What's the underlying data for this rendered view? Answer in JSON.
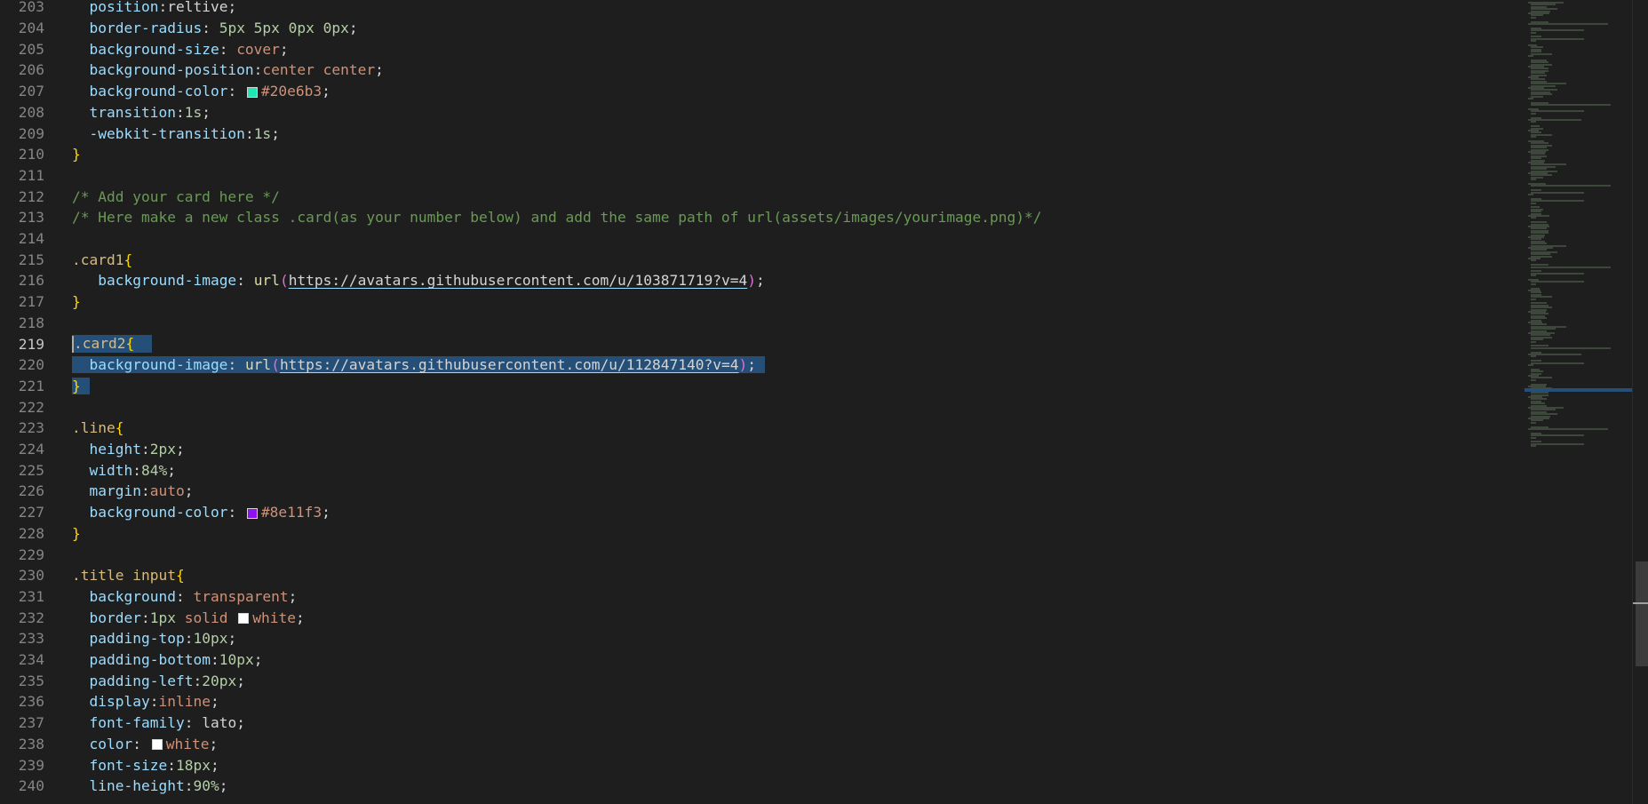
{
  "editor": {
    "active_line": "219",
    "lines": [
      {
        "n": "203",
        "tokens": [
          {
            "t": "  ",
            "c": ""
          },
          {
            "t": "position",
            "c": "t-prop"
          },
          {
            "t": ":",
            "c": "t-punc"
          },
          {
            "t": "reltive",
            "c": "t-punc"
          },
          {
            "t": ";",
            "c": "t-punc"
          }
        ]
      },
      {
        "n": "204",
        "tokens": [
          {
            "t": "  ",
            "c": ""
          },
          {
            "t": "border-radius",
            "c": "t-prop"
          },
          {
            "t": ": ",
            "c": "t-punc"
          },
          {
            "t": "5px 5px 0px 0px",
            "c": "t-num"
          },
          {
            "t": ";",
            "c": "t-punc"
          }
        ]
      },
      {
        "n": "205",
        "tokens": [
          {
            "t": "  ",
            "c": ""
          },
          {
            "t": "background-size",
            "c": "t-prop"
          },
          {
            "t": ": ",
            "c": "t-punc"
          },
          {
            "t": "cover",
            "c": "t-val"
          },
          {
            "t": ";",
            "c": "t-punc"
          }
        ]
      },
      {
        "n": "206",
        "tokens": [
          {
            "t": "  ",
            "c": ""
          },
          {
            "t": "background-position",
            "c": "t-prop"
          },
          {
            "t": ":",
            "c": "t-punc"
          },
          {
            "t": "center center",
            "c": "t-val"
          },
          {
            "t": ";",
            "c": "t-punc"
          }
        ]
      },
      {
        "n": "207",
        "tokens": [
          {
            "t": "  ",
            "c": ""
          },
          {
            "t": "background-color",
            "c": "t-prop"
          },
          {
            "t": ": ",
            "c": "t-punc"
          },
          {
            "swatch": "#20e6b3"
          },
          {
            "t": "#20e6b3",
            "c": "t-val"
          },
          {
            "t": ";",
            "c": "t-punc"
          }
        ]
      },
      {
        "n": "208",
        "tokens": [
          {
            "t": "  ",
            "c": ""
          },
          {
            "t": "transition",
            "c": "t-prop"
          },
          {
            "t": ":",
            "c": "t-punc"
          },
          {
            "t": "1s",
            "c": "t-num"
          },
          {
            "t": ";",
            "c": "t-punc"
          }
        ]
      },
      {
        "n": "209",
        "tokens": [
          {
            "t": "  ",
            "c": ""
          },
          {
            "t": "-webkit-transition",
            "c": "t-prop"
          },
          {
            "t": ":",
            "c": "t-punc"
          },
          {
            "t": "1s",
            "c": "t-num"
          },
          {
            "t": ";",
            "c": "t-punc"
          }
        ]
      },
      {
        "n": "210",
        "tokens": [
          {
            "t": "}",
            "c": "t-brace"
          }
        ]
      },
      {
        "n": "211",
        "tokens": []
      },
      {
        "n": "212",
        "tokens": [
          {
            "t": "/* Add your card here */",
            "c": "t-com"
          }
        ]
      },
      {
        "n": "213",
        "tokens": [
          {
            "t": "/* Here make a new class .card(as your number below) and add the same path of url(assets/images/yourimage.png)*/",
            "c": "t-com"
          }
        ]
      },
      {
        "n": "214",
        "tokens": []
      },
      {
        "n": "215",
        "tokens": [
          {
            "t": ".card1",
            "c": "t-sel"
          },
          {
            "t": "{",
            "c": "t-brace"
          }
        ]
      },
      {
        "n": "216",
        "tokens": [
          {
            "t": "   ",
            "c": ""
          },
          {
            "t": "background-image",
            "c": "t-prop"
          },
          {
            "t": ": ",
            "c": "t-punc"
          },
          {
            "t": "url",
            "c": "t-fn"
          },
          {
            "t": "(",
            "c": "t-paren"
          },
          {
            "t": "https://avatars.githubusercontent.com/u/103871719?v=4",
            "c": "t-url"
          },
          {
            "t": ")",
            "c": "t-paren"
          },
          {
            "t": ";",
            "c": "t-punc"
          }
        ]
      },
      {
        "n": "217",
        "tokens": [
          {
            "t": "}",
            "c": "t-brace"
          }
        ]
      },
      {
        "n": "218",
        "tokens": []
      },
      {
        "n": "219",
        "sel": true,
        "tokens": [
          {
            "cursor": true
          },
          {
            "t": ".card2",
            "c": "t-sel"
          },
          {
            "t": "{",
            "c": "t-brace"
          },
          {
            "t": "  ",
            "c": ""
          }
        ]
      },
      {
        "n": "220",
        "sel": true,
        "tokens": [
          {
            "t": "  ",
            "c": ""
          },
          {
            "t": "background-image",
            "c": "t-prop"
          },
          {
            "t": ": ",
            "c": "t-punc"
          },
          {
            "t": "url",
            "c": "t-fn"
          },
          {
            "t": "(",
            "c": "t-paren"
          },
          {
            "t": "https://avatars.githubusercontent.com/u/112847140?v=4",
            "c": "t-url"
          },
          {
            "t": ")",
            "c": "t-paren"
          },
          {
            "t": "; ",
            "c": "t-punc"
          }
        ]
      },
      {
        "n": "221",
        "sel": true,
        "tokens": [
          {
            "t": "}",
            "c": "t-brace"
          },
          {
            "t": " ",
            "c": ""
          }
        ]
      },
      {
        "n": "222",
        "tokens": []
      },
      {
        "n": "223",
        "tokens": [
          {
            "t": ".line",
            "c": "t-sel"
          },
          {
            "t": "{",
            "c": "t-brace"
          }
        ]
      },
      {
        "n": "224",
        "tokens": [
          {
            "t": "  ",
            "c": ""
          },
          {
            "t": "height",
            "c": "t-prop"
          },
          {
            "t": ":",
            "c": "t-punc"
          },
          {
            "t": "2px",
            "c": "t-num"
          },
          {
            "t": ";",
            "c": "t-punc"
          }
        ]
      },
      {
        "n": "225",
        "tokens": [
          {
            "t": "  ",
            "c": ""
          },
          {
            "t": "width",
            "c": "t-prop"
          },
          {
            "t": ":",
            "c": "t-punc"
          },
          {
            "t": "84%",
            "c": "t-num"
          },
          {
            "t": ";",
            "c": "t-punc"
          }
        ]
      },
      {
        "n": "226",
        "tokens": [
          {
            "t": "  ",
            "c": ""
          },
          {
            "t": "margin",
            "c": "t-prop"
          },
          {
            "t": ":",
            "c": "t-punc"
          },
          {
            "t": "auto",
            "c": "t-val"
          },
          {
            "t": ";",
            "c": "t-punc"
          }
        ]
      },
      {
        "n": "227",
        "tokens": [
          {
            "t": "  ",
            "c": ""
          },
          {
            "t": "background-color",
            "c": "t-prop"
          },
          {
            "t": ": ",
            "c": "t-punc"
          },
          {
            "swatch": "#8e11f3"
          },
          {
            "t": "#8e11f3",
            "c": "t-val"
          },
          {
            "t": ";",
            "c": "t-punc"
          }
        ]
      },
      {
        "n": "228",
        "tokens": [
          {
            "t": "}",
            "c": "t-brace"
          }
        ]
      },
      {
        "n": "229",
        "tokens": []
      },
      {
        "n": "230",
        "tokens": [
          {
            "t": ".title input",
            "c": "t-sel"
          },
          {
            "t": "{",
            "c": "t-brace"
          }
        ]
      },
      {
        "n": "231",
        "tokens": [
          {
            "t": "  ",
            "c": ""
          },
          {
            "t": "background",
            "c": "t-prop"
          },
          {
            "t": ": ",
            "c": "t-punc"
          },
          {
            "t": "transparent",
            "c": "t-val"
          },
          {
            "t": ";",
            "c": "t-punc"
          }
        ]
      },
      {
        "n": "232",
        "tokens": [
          {
            "t": "  ",
            "c": ""
          },
          {
            "t": "border",
            "c": "t-prop"
          },
          {
            "t": ":",
            "c": "t-punc"
          },
          {
            "t": "1px",
            "c": "t-num"
          },
          {
            "t": " solid ",
            "c": "t-val"
          },
          {
            "swatch": "#ffffff"
          },
          {
            "t": "white",
            "c": "t-val"
          },
          {
            "t": ";",
            "c": "t-punc"
          }
        ]
      },
      {
        "n": "233",
        "tokens": [
          {
            "t": "  ",
            "c": ""
          },
          {
            "t": "padding-top",
            "c": "t-prop"
          },
          {
            "t": ":",
            "c": "t-punc"
          },
          {
            "t": "10px",
            "c": "t-num"
          },
          {
            "t": ";",
            "c": "t-punc"
          }
        ]
      },
      {
        "n": "234",
        "tokens": [
          {
            "t": "  ",
            "c": ""
          },
          {
            "t": "padding-bottom",
            "c": "t-prop"
          },
          {
            "t": ":",
            "c": "t-punc"
          },
          {
            "t": "10px",
            "c": "t-num"
          },
          {
            "t": ";",
            "c": "t-punc"
          }
        ]
      },
      {
        "n": "235",
        "tokens": [
          {
            "t": "  ",
            "c": ""
          },
          {
            "t": "padding-left",
            "c": "t-prop"
          },
          {
            "t": ":",
            "c": "t-punc"
          },
          {
            "t": "20px",
            "c": "t-num"
          },
          {
            "t": ";",
            "c": "t-punc"
          }
        ]
      },
      {
        "n": "236",
        "tokens": [
          {
            "t": "  ",
            "c": ""
          },
          {
            "t": "display",
            "c": "t-prop"
          },
          {
            "t": ":",
            "c": "t-punc"
          },
          {
            "t": "inline",
            "c": "t-val"
          },
          {
            "t": ";",
            "c": "t-punc"
          }
        ]
      },
      {
        "n": "237",
        "tokens": [
          {
            "t": "  ",
            "c": ""
          },
          {
            "t": "font-family",
            "c": "t-prop"
          },
          {
            "t": ": ",
            "c": "t-punc"
          },
          {
            "t": "lato",
            "c": "t-punc"
          },
          {
            "t": ";",
            "c": "t-punc"
          }
        ]
      },
      {
        "n": "238",
        "tokens": [
          {
            "t": "  ",
            "c": ""
          },
          {
            "t": "color",
            "c": "t-prop"
          },
          {
            "t": ": ",
            "c": "t-punc"
          },
          {
            "swatch": "#ffffff"
          },
          {
            "t": "white",
            "c": "t-val"
          },
          {
            "t": ";",
            "c": "t-punc"
          }
        ]
      },
      {
        "n": "239",
        "tokens": [
          {
            "t": "  ",
            "c": ""
          },
          {
            "t": "font-size",
            "c": "t-prop"
          },
          {
            "t": ":",
            "c": "t-punc"
          },
          {
            "t": "18px",
            "c": "t-num"
          },
          {
            "t": ";",
            "c": "t-punc"
          }
        ]
      },
      {
        "n": "240",
        "tokens": [
          {
            "t": "  ",
            "c": ""
          },
          {
            "t": "line-height",
            "c": "t-prop"
          },
          {
            "t": ":",
            "c": "t-punc"
          },
          {
            "t": "90%",
            "c": "t-num"
          },
          {
            "t": ";",
            "c": "t-punc"
          }
        ]
      }
    ]
  },
  "colors": {
    "background": "#1e1e1e",
    "selection": "#264f78",
    "swatch_teal": "#20e6b3",
    "swatch_purple": "#8e11f3"
  }
}
